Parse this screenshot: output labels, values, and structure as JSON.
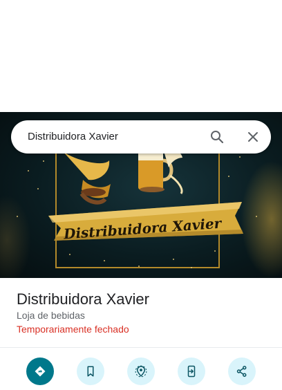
{
  "search": {
    "query": "Distribuidora Xavier"
  },
  "hero": {
    "banner_text": "Distribuidora Xavier"
  },
  "place": {
    "name": "Distribuidora Xavier",
    "category": "Loja de bebidas",
    "status": "Temporariamente fechado"
  },
  "actions": [
    {
      "icon": "directions-icon"
    },
    {
      "icon": "bookmark-icon"
    },
    {
      "icon": "nearby-icon"
    },
    {
      "icon": "send-to-phone-icon"
    },
    {
      "icon": "share-icon"
    }
  ],
  "colors": {
    "accent": "#00788b",
    "action_background": "#d9f4fb",
    "status_closed": "#d93025",
    "banner_gold": "#d8ac3c"
  }
}
